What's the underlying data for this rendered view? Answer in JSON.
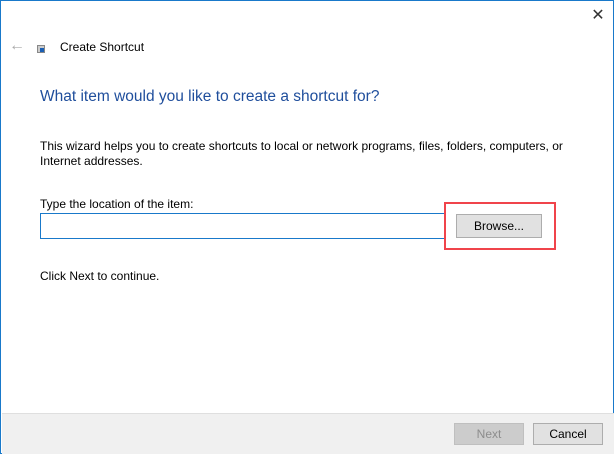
{
  "window": {
    "title": "Create Shortcut",
    "close_icon": "close-icon",
    "back_icon": "back-arrow-icon"
  },
  "page": {
    "heading": "What item would you like to create a shortcut for?",
    "description": "This wizard helps you to create shortcuts to local or network programs, files, folders, computers, or Internet addresses.",
    "location_label": "Type the location of the item:",
    "location_value": "",
    "browse_label": "Browse...",
    "continue_hint": "Click Next to continue."
  },
  "footer": {
    "next_label": "Next",
    "cancel_label": "Cancel"
  },
  "highlight_color": "#f0444b"
}
